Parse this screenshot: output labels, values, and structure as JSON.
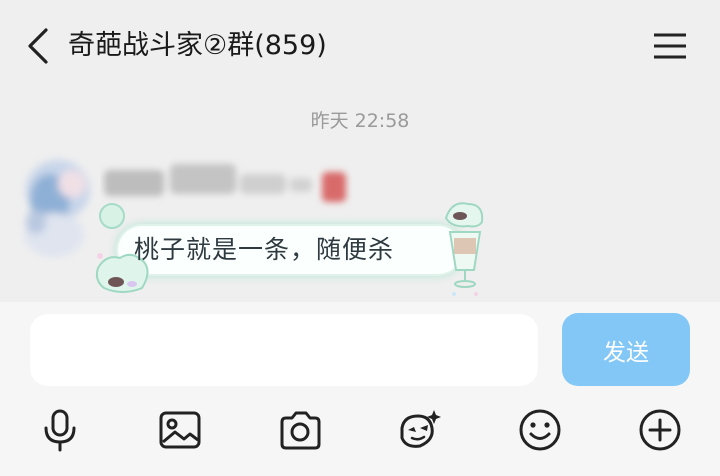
{
  "header": {
    "title": "奇葩战斗家②群(859)",
    "back_icon": "chevron-left-icon",
    "menu_icon": "menu-icon"
  },
  "chat": {
    "timestamp": "昨天 22:58",
    "message": {
      "text": "桃子就是一条，随便杀"
    }
  },
  "composer": {
    "input_value": "",
    "send_label": "发送",
    "send_color": "#7cc5f6"
  },
  "toolbar": {
    "icons": [
      "microphone-icon",
      "image-icon",
      "camera-icon",
      "sticker-icon",
      "emoji-icon",
      "plus-icon"
    ]
  }
}
